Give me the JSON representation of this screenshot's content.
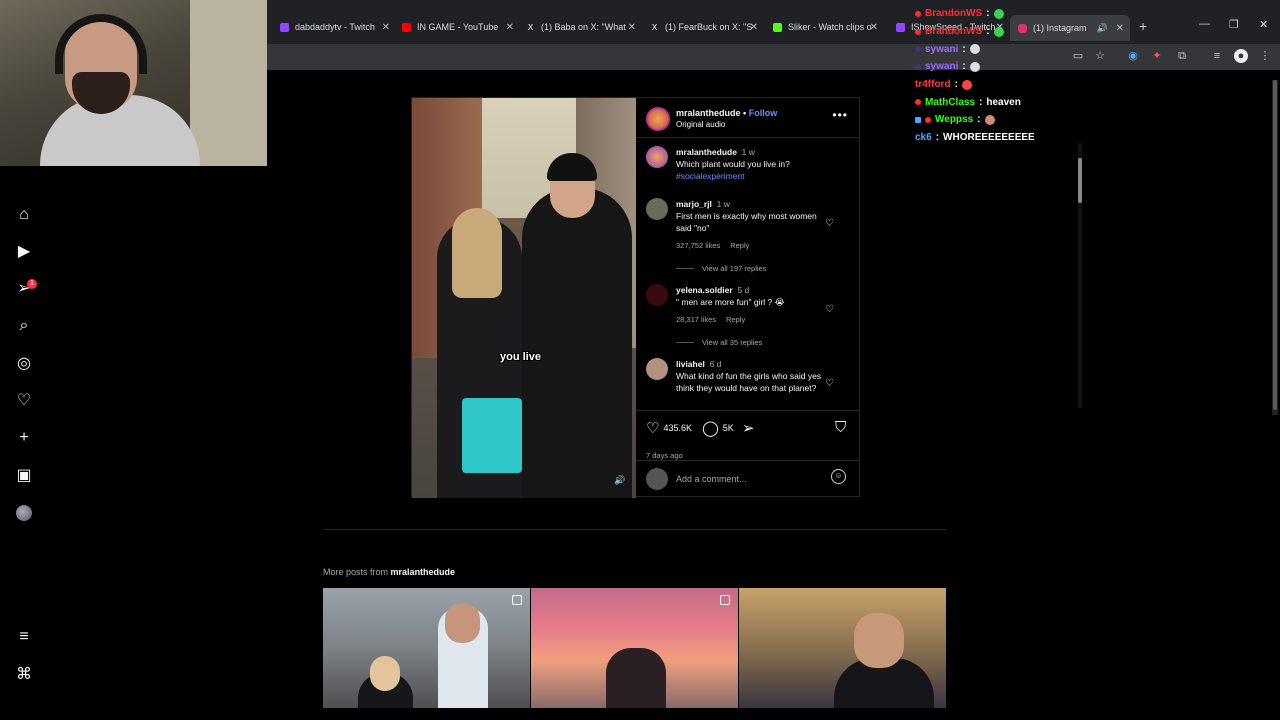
{
  "browser": {
    "tabs": [
      {
        "title": "dabdaddytv - Twitch",
        "color": "#9146ff"
      },
      {
        "title": "IN GAME - YouTube",
        "color": "#ff0000"
      },
      {
        "title": "(1) Baba on X: \"What",
        "color": "#e7e9ea"
      },
      {
        "title": "(1) FearBuck on X: \"S",
        "color": "#e7e9ea"
      },
      {
        "title": "Sliker - Watch clips o",
        "color": "#53fc18"
      },
      {
        "title": "IShowSpeed - Twitch",
        "color": "#9146ff"
      },
      {
        "title": "(1) Instagram",
        "color": "#e1306c"
      }
    ],
    "new_tab_label": "+"
  },
  "chat": [
    {
      "user": "BrandonWS",
      "color": "#ff2d2d",
      "message": ""
    },
    {
      "user": "BrandonWS",
      "color": "#ff2d2d",
      "message": ""
    },
    {
      "user": "sywani",
      "color": "#9b6cff",
      "message": ""
    },
    {
      "user": "sywani",
      "color": "#9b6cff",
      "message": ""
    },
    {
      "user": "tr4fford",
      "color": "#ff3b3b",
      "message": ""
    },
    {
      "user": "MathClass",
      "color": "#39ff14",
      "message": "heaven"
    },
    {
      "user": "Weppss",
      "color": "#39ff14",
      "message": ""
    },
    {
      "user": "ck6",
      "color": "#4aa8ff",
      "message": "WHOREEEEEEEEE"
    }
  ],
  "sidebar": {
    "notification_count": "1"
  },
  "post": {
    "username": "mralanthedude",
    "follow_label": "Follow",
    "separator": "•",
    "audio_label": "Original audio",
    "video_caption": "you live",
    "caption": {
      "user": "mralanthedude",
      "time": "1 w",
      "text": "Which plant would you live in?",
      "hashtag": "#socialexperiment"
    },
    "comments": [
      {
        "user": "marjo_rjl",
        "time": "1 w",
        "text": "First men is exactly why most women said \"no\"",
        "likes": "327,752 likes",
        "reply": "Reply",
        "view_replies": "View all 197 replies",
        "avatar_color": "#6a6a5a"
      },
      {
        "user": "yelena.soldier",
        "time": "5 d",
        "text": "\" men are more fun\" girl ? 😭",
        "likes": "28,317 likes",
        "reply": "Reply",
        "view_replies": "View all 35 replies",
        "avatar_color": "#3a0a10"
      },
      {
        "user": "liviahel",
        "time": "6 d",
        "text": "What kind of fun the girls who said yes think they would have on that planet?",
        "likes": "",
        "reply": "",
        "view_replies": "",
        "avatar_color": "#b49080"
      }
    ],
    "like_count": "435.6K",
    "comment_count": "5K",
    "date": "7 days ago",
    "add_comment_placeholder": "Add a comment..."
  },
  "more_posts": {
    "label": "More posts from",
    "user": "mralanthedude"
  }
}
